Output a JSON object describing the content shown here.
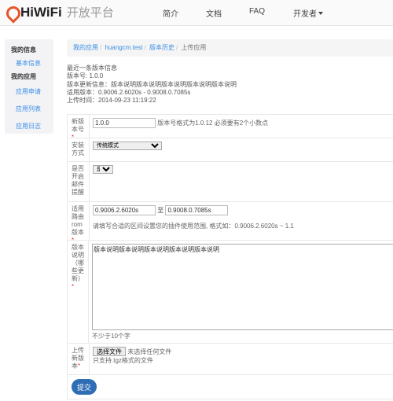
{
  "header": {
    "brand": "HiWiFi",
    "brand_sub": "开放平台",
    "nav": [
      "简介",
      "文档",
      "FAQ",
      "开发者"
    ]
  },
  "sidebar": {
    "sections": [
      {
        "title": "我的信息",
        "items": [
          "基本信息"
        ]
      },
      {
        "title": "我的应用",
        "items": [
          "应用申请",
          "应用列表",
          "应用日志"
        ]
      }
    ]
  },
  "breadcrumb": [
    "我的应用",
    "huangcm.test",
    "版本历史",
    "上传应用"
  ],
  "latest": {
    "title": "最近一条版本信息",
    "version": "版本号: 1.0.0",
    "update": "版本更新信息：版本说明版本说明版本说明版本说明版本说明",
    "applicable": "适用版本：0.9006.2.6020s - 0.9008.0.7085s",
    "uploaded": "上传时间：2014-09-23 11:19:22"
  },
  "form": {
    "version": {
      "label": "新版本号",
      "value": "1.0.0",
      "hint": "版本号格式为1.0.12 必须要有2个小数点"
    },
    "install": {
      "label": "安装方式",
      "value": "传统模式"
    },
    "email": {
      "label": "是否开启邮件提醒",
      "value": "是"
    },
    "rom": {
      "label": "适用路由rom版本",
      "from": "0.9006.2.6020s",
      "to_label": "至",
      "to": "0.9008.0.7085s",
      "hint": "请填写合适的区间设置您的插件使用范围, 格式如：0.9006.2.6020s ~ 1.1"
    },
    "desc": {
      "label": "版本说明（哪些更新）",
      "value": "版本说明版本说明版本说明版本说明版本说明",
      "hint": "不少于10个字"
    },
    "upload": {
      "label": "上传新版本",
      "button": "选择文件",
      "status": "未选择任何文件",
      "hint": "只支持.tgz格式的文件"
    },
    "required_mark": "*",
    "submit": "提交"
  },
  "colors": {
    "accent": "#3a8ee6",
    "logo": "#e8542a",
    "button": "#2f6db5"
  }
}
